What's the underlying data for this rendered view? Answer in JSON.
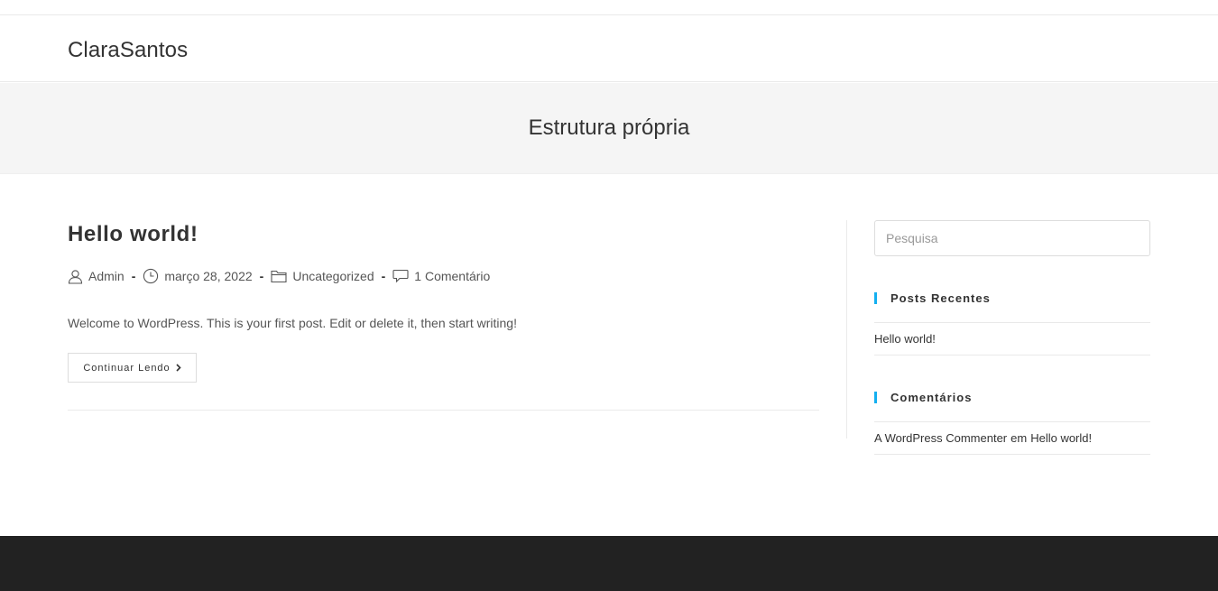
{
  "site": {
    "title": "ClaraSantos"
  },
  "page_header": {
    "title": "Estrutura própria"
  },
  "post": {
    "title": "Hello world!",
    "meta": {
      "author": "Admin",
      "date": "março 28, 2022",
      "category": "Uncategorized",
      "comments": "1 Comentário",
      "separator": "-"
    },
    "excerpt": "Welcome to WordPress. This is your first post. Edit or delete it, then start writing!",
    "read_more": "Continuar Lendo"
  },
  "sidebar": {
    "search": {
      "placeholder": "Pesquisa",
      "value": ""
    },
    "recent_posts": {
      "title": "Posts Recentes",
      "items": [
        "Hello world!"
      ]
    },
    "comments": {
      "title": "Comentários",
      "items": [
        {
          "author": "A WordPress Commenter",
          "connector": "em",
          "post": "Hello world!"
        }
      ]
    }
  },
  "colors": {
    "accent": "#13aff0",
    "footer_bg": "#222222",
    "page_header_bg": "#f5f5f5",
    "text": "#333333"
  },
  "icons": [
    "user-icon",
    "clock-icon",
    "folder-icon",
    "comment-icon",
    "chevron-right-icon"
  ]
}
